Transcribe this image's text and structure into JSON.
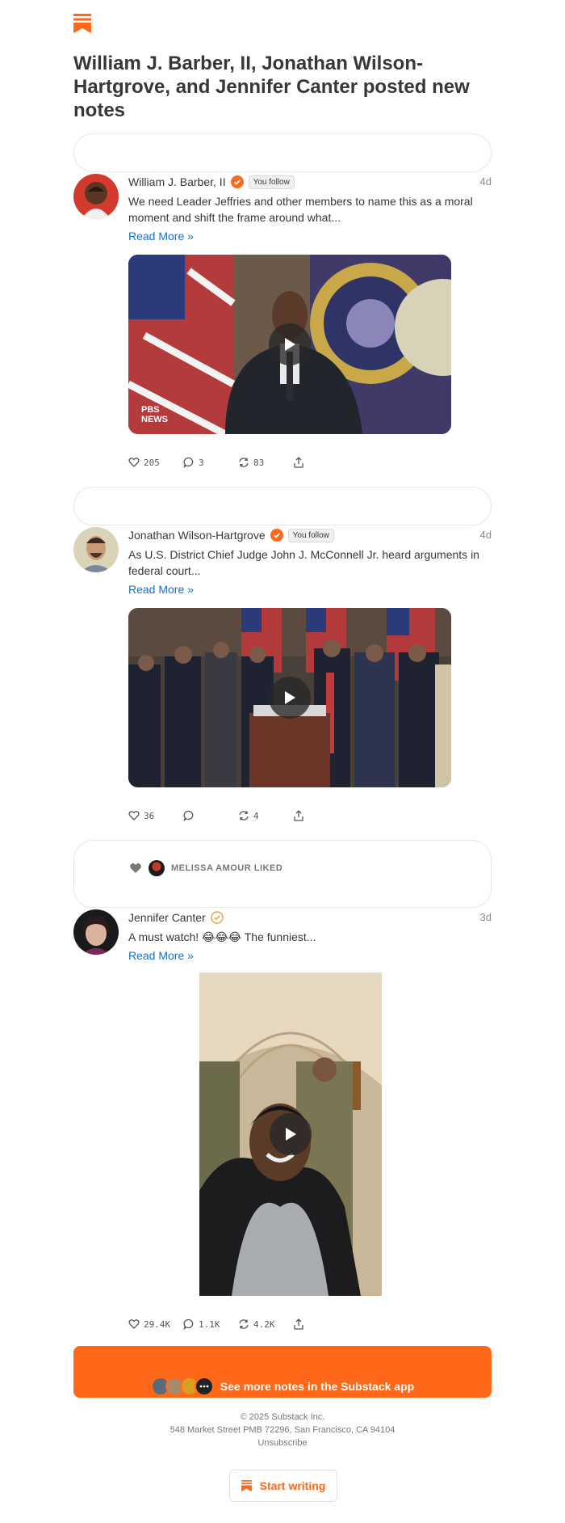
{
  "brand": {
    "accent": "#ff6719",
    "link": "#1a6ec6",
    "logo_icon": "substack-bookmark-icon"
  },
  "headline": "William J. Barber, II, Jonathan Wilson-Hartgrove, and Jennifer Canter posted new notes",
  "notes": [
    {
      "author": "William J. Barber, II",
      "follow_label": "You follow",
      "age": "4d",
      "text": "We need Leader Jeffries and other members to name this as a moral moment and shift the frame around what...",
      "read_more": "Read More »",
      "media_watermark": "PBS NEWS",
      "stats": {
        "likes": "205",
        "comments": "3",
        "restacks": "83"
      }
    },
    {
      "author": "Jonathan Wilson-Hartgrove",
      "follow_label": "You follow",
      "age": "4d",
      "text": "As U.S. District Chief Judge John J. McConnell Jr. heard arguments in federal court...",
      "read_more": "Read More »",
      "stats": {
        "likes": "36",
        "comments": "",
        "restacks": "4"
      }
    },
    {
      "liked_by": "MELISSA AMOUR LIKED",
      "author": "Jennifer Canter",
      "age": "3d",
      "text": "A must watch! 😂😂😂 The funniest...",
      "read_more": "Read More »",
      "stats": {
        "likes": "29.4K",
        "comments": "1.1K",
        "restacks": "4.2K"
      }
    }
  ],
  "cta": {
    "label": "See more notes in the Substack app"
  },
  "footer": {
    "copyright": "© 2025 Substack Inc.",
    "address": "548 Market Street PMB 72296, San Francisco, CA 94104",
    "unsubscribe": "Unsubscribe"
  },
  "start_writing": "Start writing"
}
